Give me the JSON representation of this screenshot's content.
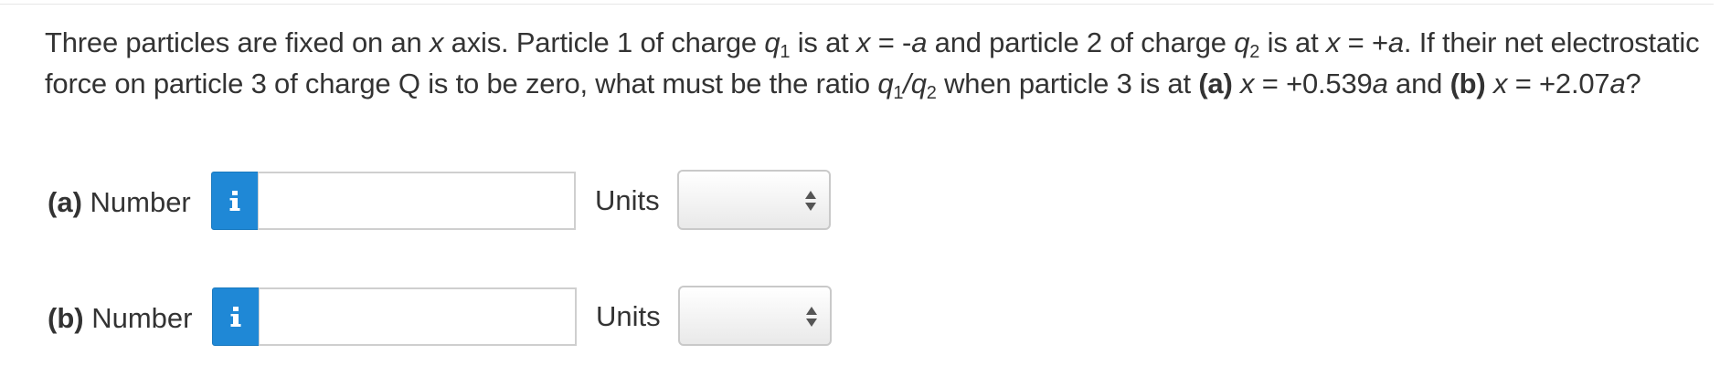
{
  "question": {
    "t1": "Three particles are fixed on an ",
    "x1": "x",
    "t2": " axis. Particle 1 of charge ",
    "q1_sym": "q",
    "q1_sub": "1",
    "t3": " is at ",
    "x2": "x",
    "t4": " = -",
    "a1": "a",
    "t5": " and particle 2 of charge ",
    "q2_sym": "q",
    "q2_sub": "2",
    "t6": " is at ",
    "x3": "x",
    "t7": " = +",
    "a2": "a",
    "t8": ". If their net electrostatic force on particle 3 of charge Q is to be zero, what must be the ratio ",
    "r_q1": "q",
    "r_q1_sub": "1",
    "r_slash": "/",
    "r_q2": "q",
    "r_q2_sub": "2",
    "t9": " when particle 3 is at ",
    "pa": "(a)",
    "t10": " ",
    "x4": "x",
    "t11": " = +0.539",
    "a3": "a",
    "t12": " and ",
    "pb": "(b)",
    "t13": " ",
    "x5": "x",
    "t14": " = +2.07",
    "a4": "a",
    "t15": "?"
  },
  "answers": [
    {
      "part": "(a)",
      "label": " Number",
      "info_icon": "info-icon",
      "value": "",
      "units_label": "Units",
      "units_value": ""
    },
    {
      "part": "(b)",
      "label": " Number",
      "info_icon": "info-icon",
      "value": "",
      "units_label": "Units",
      "units_value": ""
    }
  ],
  "colors": {
    "info_button": "#1f88d6",
    "text": "#333333",
    "input_border": "#cfcfcf"
  }
}
